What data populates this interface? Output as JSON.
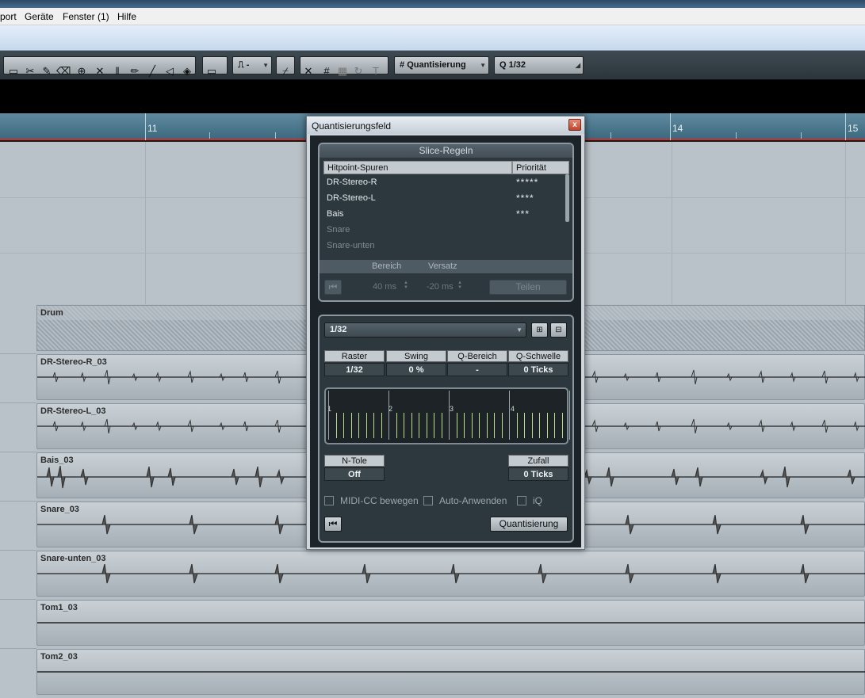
{
  "menu": {
    "items": [
      "port",
      "Geräte",
      "Fenster (1)",
      "Hilfe"
    ]
  },
  "toolbar": {
    "snap_type": "-",
    "quant_label": "Quantisierung",
    "quant_value": "1/32"
  },
  "ruler": {
    "labels": [
      "11",
      "14",
      "15"
    ]
  },
  "tracks": {
    "folder_name": "Drum",
    "events": [
      "DR-Stereo-R_03",
      "DR-Stereo-L_03",
      "Bais_03",
      "Snare_03",
      "Snare-unten_03",
      "Tom1_03",
      "Tom2_03"
    ]
  },
  "dialog": {
    "title": "Quantisierungsfeld",
    "close": "x",
    "slice": {
      "header": "Slice-Regeln",
      "col_tracks": "Hitpoint-Spuren",
      "col_priority": "Priorität",
      "rows": [
        {
          "name": "DR-Stereo-R",
          "priority": "*****"
        },
        {
          "name": "DR-Stereo-L",
          "priority": "****"
        },
        {
          "name": "Bais",
          "priority": "***"
        },
        {
          "name": "Snare",
          "priority": ""
        },
        {
          "name": "Snare-unten",
          "priority": ""
        }
      ],
      "bereich_label": "Bereich",
      "versatz_label": "Versatz",
      "bereich_value": "40 ms",
      "versatz_value": "-20 ms",
      "teilen": "Teilen"
    },
    "quant": {
      "preset": "1/32",
      "raster_label": "Raster",
      "raster_value": "1/32",
      "swing_label": "Swing",
      "swing_value": "0 %",
      "qbereich_label": "Q-Bereich",
      "qbereich_value": "-",
      "qschwelle_label": "Q-Schwelle",
      "qschwelle_value": "0 Ticks",
      "beats": [
        "1",
        "2",
        "3",
        "4"
      ],
      "ntole_label": "N-Tole",
      "ntole_value": "Off",
      "zufall_label": "Zufall",
      "zufall_value": "0 Ticks",
      "midi_cc": "MIDI-CC bewegen",
      "auto": "Auto-Anwenden",
      "iq": "iQ",
      "apply": "Quantisierung"
    }
  }
}
